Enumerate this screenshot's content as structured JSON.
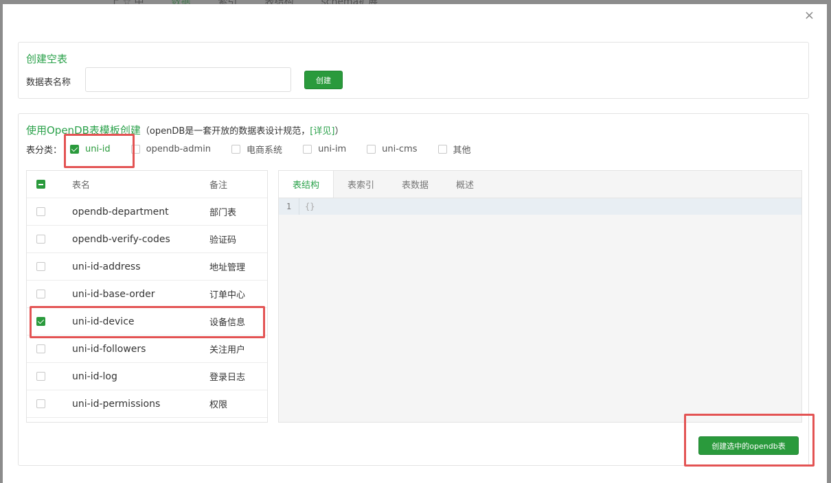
{
  "background": {
    "tabs": [
      "上 ☆ 中",
      "数据",
      "索引",
      "表结构",
      "schema扩展"
    ]
  },
  "dialog": {
    "close_icon": "×",
    "create_empty": {
      "title": "创建空表",
      "name_label": "数据表名称",
      "name_value": "",
      "create_button": "创建"
    },
    "opendb": {
      "title": "使用OpenDB表模板创建",
      "subtitle": "（openDB是一套开放的数据表设计规范，",
      "link": "[详见]",
      "subtitle_end": "）",
      "category_label": "表分类：",
      "categories": [
        {
          "label": "uni-id",
          "checked": true
        },
        {
          "label": "opendb-admin",
          "checked": false
        },
        {
          "label": "电商系统",
          "checked": false
        },
        {
          "label": "uni-im",
          "checked": false
        },
        {
          "label": "uni-cms",
          "checked": false
        },
        {
          "label": "其他",
          "checked": false
        }
      ],
      "table": {
        "headers": {
          "name": "表名",
          "note": "备注"
        },
        "rows": [
          {
            "name": "opendb-department",
            "note": "部门表",
            "checked": false
          },
          {
            "name": "opendb-verify-codes",
            "note": "验证码",
            "checked": false
          },
          {
            "name": "uni-id-address",
            "note": "地址管理",
            "checked": false
          },
          {
            "name": "uni-id-base-order",
            "note": "订单中心",
            "checked": false
          },
          {
            "name": "uni-id-device",
            "note": "设备信息",
            "checked": true
          },
          {
            "name": "uni-id-followers",
            "note": "关注用户",
            "checked": false
          },
          {
            "name": "uni-id-log",
            "note": "登录日志",
            "checked": false
          },
          {
            "name": "uni-id-permissions",
            "note": "权限",
            "checked": false
          }
        ]
      },
      "editor": {
        "tabs": [
          "表结构",
          "表索引",
          "表数据",
          "概述"
        ],
        "active_tab": "表结构",
        "line_number": "1",
        "code": "{}"
      },
      "create_selected_button": "创建选中的opendb表"
    }
  },
  "colors": {
    "accent": "#2aa14a",
    "button": "#2a9a3c",
    "highlight": "#e35353"
  }
}
